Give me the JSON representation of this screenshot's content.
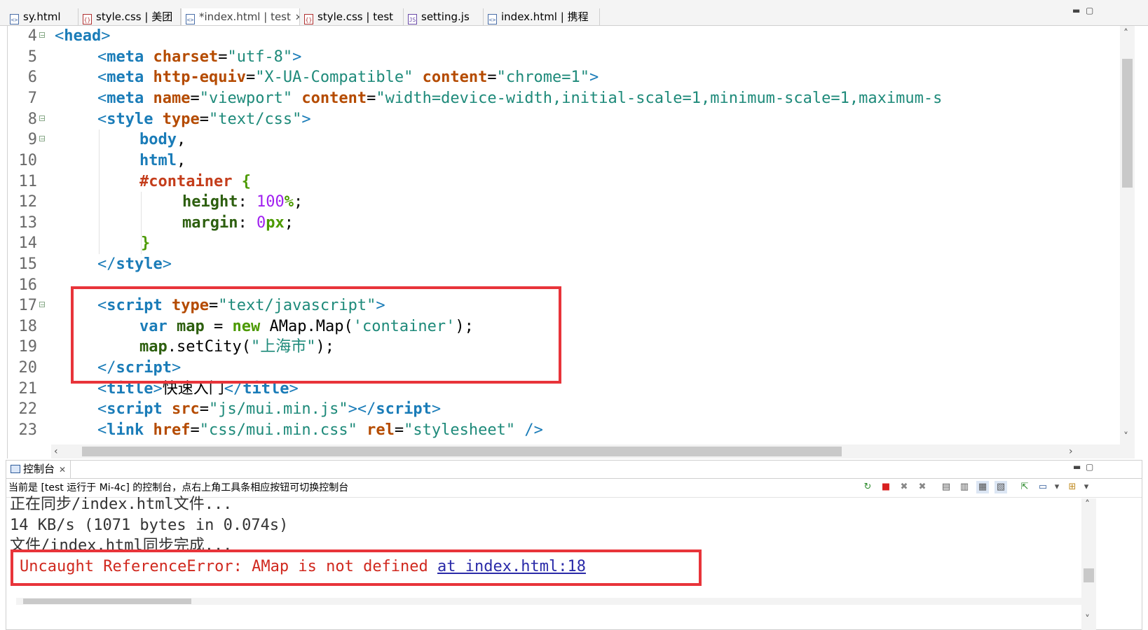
{
  "tabs": [
    {
      "label": "sy.html",
      "icon": "html-file-icon"
    },
    {
      "label": "style.css | 美团",
      "icon": "css-file-icon"
    },
    {
      "label": "*index.html | test",
      "icon": "html-file-icon",
      "active": true
    },
    {
      "label": "style.css | test",
      "icon": "css-file-icon"
    },
    {
      "label": "setting.js",
      "icon": "js-file-icon"
    },
    {
      "label": "index.html | 携程",
      "icon": "html-file-icon"
    }
  ],
  "editor": {
    "line_numbers": [
      "4",
      "5",
      "6",
      "7",
      "8",
      "9",
      "10",
      "11",
      "12",
      "13",
      "14",
      "15",
      "16",
      "17",
      "18",
      "19",
      "20",
      "21",
      "22",
      "23"
    ],
    "lines": {
      "l4": {
        "a": "<",
        "b": "head",
        "c": ">"
      },
      "l5": {
        "a": "<",
        "b": "meta",
        "c": " ",
        "d": "charset",
        "e": "=",
        "f": "\"utf-8\"",
        "g": ">"
      },
      "l6": {
        "a": "<",
        "b": "meta",
        "c": " ",
        "d": "http-equiv",
        "e": "=",
        "f": "\"X-UA-Compatible\"",
        "g": " ",
        "h": "content",
        "i": "=",
        "j": "\"chrome=1\"",
        "k": ">"
      },
      "l7": {
        "a": "<",
        "b": "meta",
        "c": " ",
        "d": "name",
        "e": "=",
        "f": "\"viewport\"",
        "g": " ",
        "h": "content",
        "i": "=",
        "j": "\"width=device-width,initial-scale=1,minimum-scale=1,maximum-s"
      },
      "l8": {
        "a": "<",
        "b": "style",
        "c": " ",
        "d": "type",
        "e": "=",
        "f": "\"text/css\"",
        "g": ">"
      },
      "l9": {
        "a": "body",
        ",": ","
      },
      "l10": {
        "a": "html",
        ",": ","
      },
      "l11": {
        "a": "#container",
        " ": " {"
      },
      "l12": {
        "a": "height",
        ":": ": ",
        "n": "100",
        "u": "%",
        ";": ";"
      },
      "l13": {
        "a": "margin",
        ":": ": ",
        "n": "0",
        "u": "px",
        ";": ";"
      },
      "l14": {
        "a": "}"
      },
      "l15": {
        "a": "</",
        "b": "style",
        "c": ">"
      },
      "l17": {
        "a": "<",
        "b": "script",
        "c": " ",
        "d": "type",
        "e": "=",
        "f": "\"text/javascript\"",
        "g": ">"
      },
      "l18": {
        "a": "var",
        "b": " ",
        "c": "map",
        "d": " = ",
        "e": "new",
        "f": " AMap.Map(",
        "g": "'container'",
        "h": ");"
      },
      "l19": {
        "a": "map",
        "b": ".setCity(",
        "c": "\"上海市\"",
        "d": ");"
      },
      "l20": {
        "a": "</",
        "b": "script",
        "c": ">"
      },
      "l21": {
        "a": "<",
        "b": "title",
        "c": ">",
        "d": "快速入门",
        "e": "</",
        "f": "title",
        "g": ">"
      },
      "l22": {
        "a": "<",
        "b": "script",
        "c": " ",
        "d": "src",
        "e": "=",
        "f": "\"js/mui.min.js\"",
        "g": "></",
        "h": "script",
        "i": ">"
      },
      "l23": {
        "a": "<",
        "b": "link",
        "c": " ",
        "d": "href",
        "e": "=",
        "f": "\"css/mui.min.css\"",
        "g": " ",
        "h": "rel",
        "i": "=",
        "j": "\"stylesheet\"",
        "k": " />"
      }
    }
  },
  "console": {
    "tab_label": "控制台",
    "header": "当前是 [test 运行于 Mi-4c] 的控制台，点右上角工具条相应按钮可切换控制台",
    "lines": [
      "正在同步/index.html文件...",
      "14 KB/s (1071 bytes in 0.074s)",
      "文件/index.html同步完成..."
    ],
    "error_text": "Uncaught ReferenceError: AMap is not defined ",
    "error_link": "at index.html:18"
  },
  "colors": {
    "highlight_box": "#e8343a",
    "error_text": "#d0281e"
  }
}
